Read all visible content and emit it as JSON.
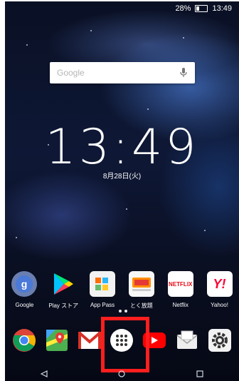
{
  "status_bar": {
    "battery": "28%",
    "time": "13:49"
  },
  "search": {
    "placeholder": "Google"
  },
  "clock": {
    "time": "13:49",
    "date": "8月28日(火)"
  },
  "apps": [
    {
      "label": "Google",
      "icon": "google-folder-icon"
    },
    {
      "label": "Play ストア",
      "icon": "play-store-icon"
    },
    {
      "label": "App Pass",
      "icon": "app-pass-icon"
    },
    {
      "label": "とく放題",
      "icon": "toku-houdai-icon"
    },
    {
      "label": "Netflix",
      "icon": "netflix-icon",
      "text": "NETFLIX"
    },
    {
      "label": "Yahoo!",
      "icon": "yahoo-icon",
      "text": "Y!"
    }
  ],
  "dock": [
    {
      "icon": "chrome-icon"
    },
    {
      "icon": "maps-icon"
    },
    {
      "icon": "gmail-icon"
    },
    {
      "icon": "app-drawer-icon"
    },
    {
      "icon": "youtube-icon"
    },
    {
      "icon": "email-icon"
    },
    {
      "icon": "settings-icon"
    }
  ],
  "colors": {
    "highlight": "#ff1e1e",
    "netflix_red": "#e50914",
    "yahoo_red": "#ff0033"
  }
}
